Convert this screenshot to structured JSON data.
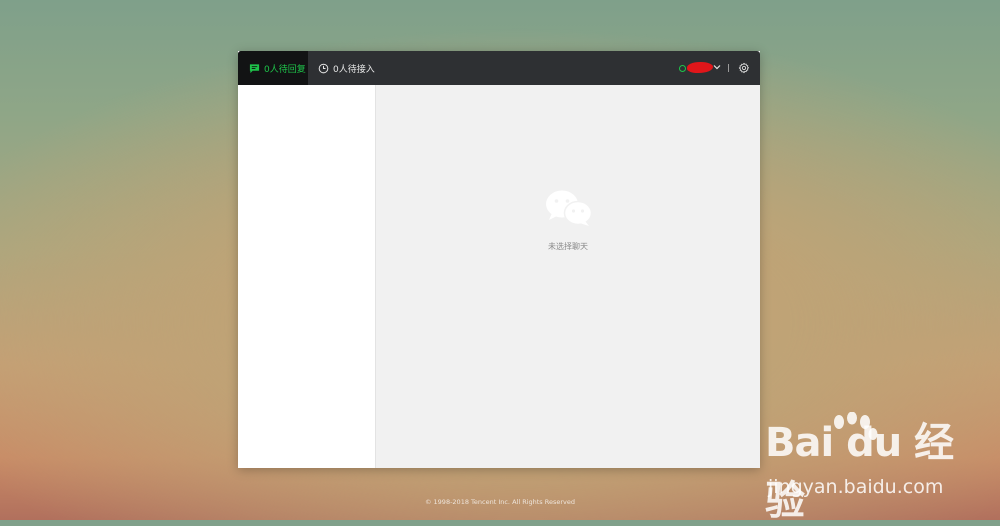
{
  "topbar": {
    "tab_pending_reply": "0人待回复",
    "tab_waiting_access": "0人待接入",
    "account_name": "",
    "status_color": "#1ec44a"
  },
  "main": {
    "empty_text": "未选择聊天"
  },
  "footer": {
    "copyright": "© 1998-2018 Tencent Inc. All Rights Reserved"
  },
  "watermark": {
    "logo": "Bai du 经验",
    "url": "jingyan.baidu.com"
  },
  "icons": {
    "pending": "chat-bubble-icon",
    "waiting": "clock-icon",
    "chevron": "chevron-down-icon",
    "settings": "gear-icon",
    "empty": "wechat-icon"
  },
  "colors": {
    "accent": "#1ec44a",
    "topbar": "#2e3033"
  }
}
